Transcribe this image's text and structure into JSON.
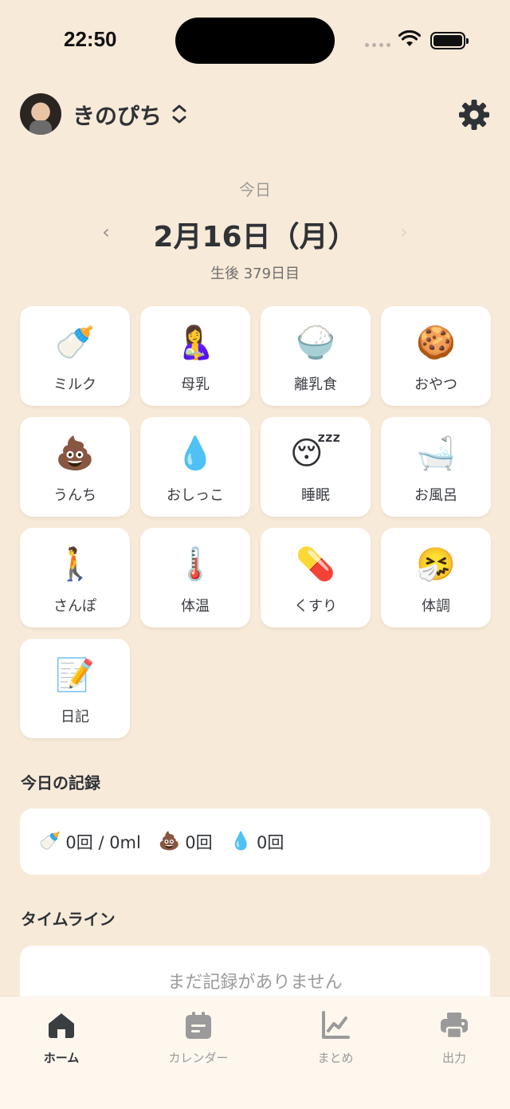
{
  "status_bar": {
    "time": "22:50"
  },
  "header": {
    "profile_name": "きのぴち"
  },
  "date": {
    "today_label": "今日",
    "title": "2月16日（月）",
    "age": "生後 379日目",
    "prev_glyph": "‹",
    "next_glyph": "›"
  },
  "activities": [
    {
      "label": "ミルク",
      "emoji": "🍼",
      "icon": "baby-bottle-icon"
    },
    {
      "label": "母乳",
      "emoji": "🤱",
      "icon": "breastfeeding-icon"
    },
    {
      "label": "離乳食",
      "emoji": "🍚",
      "icon": "rice-bowl-icon"
    },
    {
      "label": "おやつ",
      "emoji": "🍪",
      "icon": "cookie-icon"
    },
    {
      "label": "うんち",
      "emoji": "💩",
      "icon": "poop-icon"
    },
    {
      "label": "おしっこ",
      "emoji": "💧",
      "icon": "droplet-icon"
    },
    {
      "label": "睡眠",
      "emoji": "😴",
      "icon": "sleeping-face-icon"
    },
    {
      "label": "お風呂",
      "emoji": "🛁",
      "icon": "bathtub-icon"
    },
    {
      "label": "さんぽ",
      "emoji": "🚶",
      "icon": "walking-person-icon"
    },
    {
      "label": "体温",
      "emoji": "🌡️",
      "icon": "thermometer-icon"
    },
    {
      "label": "くすり",
      "emoji": "💊",
      "icon": "pill-icon"
    },
    {
      "label": "体調",
      "emoji": "🤧",
      "icon": "sneezing-face-icon"
    },
    {
      "label": "日記",
      "emoji": "📝",
      "icon": "memo-icon"
    }
  ],
  "records": {
    "title": "今日の記録",
    "milk_emoji": "🍼",
    "milk": "0回 / 0ml",
    "poop_emoji": "💩",
    "poop": "0回",
    "pee_emoji": "💧",
    "pee": "0回"
  },
  "timeline": {
    "title": "タイムライン",
    "empty": "まだ記録がありません"
  },
  "nav": [
    {
      "label": "ホーム",
      "icon": "home-icon",
      "active": true
    },
    {
      "label": "カレンダー",
      "icon": "calendar-icon",
      "active": false
    },
    {
      "label": "まとめ",
      "icon": "chart-icon",
      "active": false
    },
    {
      "label": "出力",
      "icon": "printer-icon",
      "active": false
    }
  ],
  "colors": {
    "background": "#f8ead8",
    "card": "#ffffff",
    "text": "#2f3237",
    "muted": "#9a9a9a",
    "nav_active": "#3a3d42",
    "nav_inactive": "#9a9a9a"
  }
}
